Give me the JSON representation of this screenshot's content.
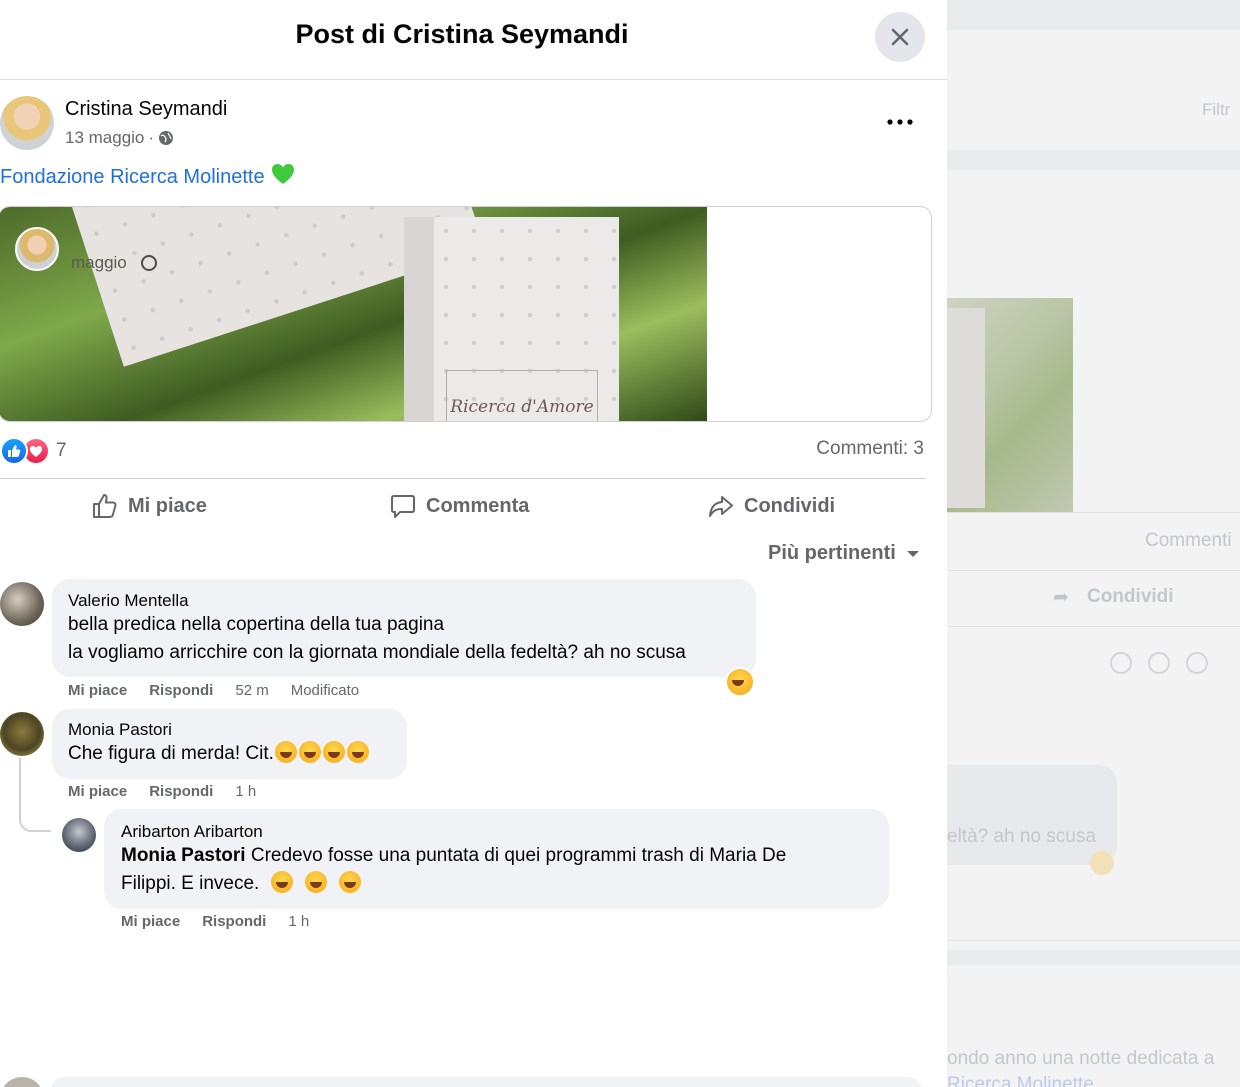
{
  "modal": {
    "title": "Post di Cristina Seymandi"
  },
  "post": {
    "author": "Cristina Seymandi",
    "date": "13 maggio",
    "separator": "·",
    "text": "Fondazione Ricerca Molinette",
    "text_emoji": "💚",
    "shared": {
      "date": "maggio",
      "image_caption": "Ricerca d'Amore"
    },
    "reactions_count": "7",
    "comments_count": "Commenti: 3"
  },
  "actions": {
    "like": "Mi piace",
    "comment": "Commenta",
    "share": "Condividi"
  },
  "sort_label": "Più pertinenti",
  "comments": [
    {
      "name": "Valerio Mentella",
      "lines": [
        "bella predica nella copertina della tua pagina",
        "la vogliamo arricchire con la giornata mondiale della fedeltà? ah no scusa"
      ],
      "like": "Mi piace",
      "reply": "Rispondi",
      "time": "52 m",
      "edited": "Modificato"
    },
    {
      "name": "Monia Pastori",
      "text": "Che figura di merda! Cit.",
      "like": "Mi piace",
      "reply": "Rispondi",
      "time": "1 h"
    },
    {
      "name": "Aribarton Aribarton",
      "mention": "Monia Pastori",
      "line1": " Credevo fosse una puntata di quei programmi trash di Maria De",
      "line2": "Filippi. E invece.",
      "like": "Mi piace",
      "reply": "Rispondi",
      "time": "1 h"
    }
  ],
  "background": {
    "text_comments": "Commenti",
    "text_share": "Condividi",
    "text_comment_fragment": "eltà? ah no scusa",
    "text_post_fragment": "ondo anno una notte dedicata a",
    "text_link_fragment": "Ricerca Molinette",
    "text_top_fragment": "Filtr"
  },
  "colors": {
    "link": "#216fdb",
    "secondary_text": "#65676b",
    "bubble": "#f0f2f5",
    "like_blue": "#1877f2",
    "love_red": "#f33e58"
  }
}
